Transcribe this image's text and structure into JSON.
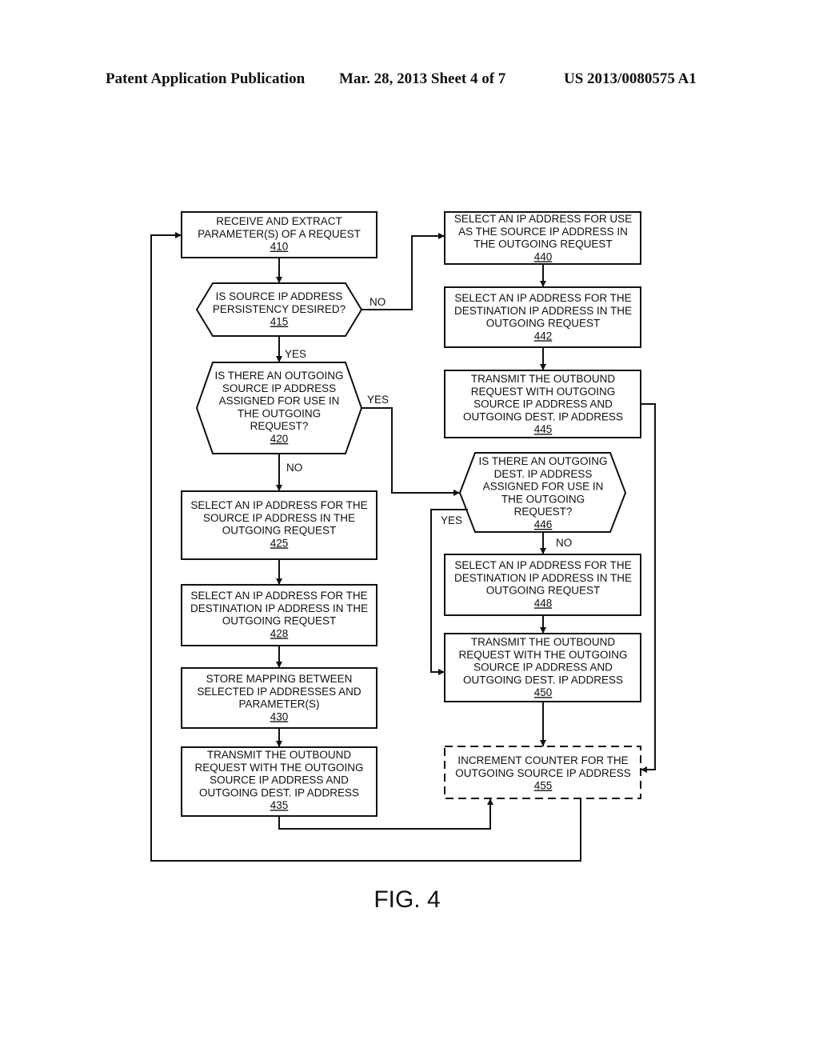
{
  "header": {
    "left": "Patent Application Publication",
    "center": "Mar. 28, 2013  Sheet 4 of 7",
    "right": "US 2013/0080575 A1"
  },
  "figure_label": "FIG. 4",
  "nodes": {
    "n410": {
      "lines": [
        "RECEIVE AND EXTRACT",
        "PARAMETER(S) OF A REQUEST"
      ],
      "ref": "410",
      "shape": "process"
    },
    "n415": {
      "lines": [
        "IS SOURCE IP ADDRESS",
        "PERSISTENCY DESIRED?"
      ],
      "ref": "415",
      "shape": "decision"
    },
    "n420": {
      "lines": [
        "IS THERE AN OUTGOING",
        "SOURCE IP ADDRESS",
        "ASSIGNED FOR USE IN",
        "THE OUTGOING",
        "REQUEST?"
      ],
      "ref": "420",
      "shape": "decision"
    },
    "n425": {
      "lines": [
        "SELECT AN IP ADDRESS FOR THE",
        "SOURCE IP ADDRESS IN THE",
        "OUTGOING REQUEST"
      ],
      "ref": "425",
      "shape": "process"
    },
    "n428": {
      "lines": [
        "SELECT AN IP ADDRESS FOR THE",
        "DESTINATION IP ADDRESS IN THE",
        "OUTGOING REQUEST"
      ],
      "ref": "428",
      "shape": "process"
    },
    "n430": {
      "lines": [
        "STORE MAPPING BETWEEN",
        "SELECTED IP ADDRESSES AND",
        "PARAMETER(S)"
      ],
      "ref": "430",
      "shape": "process"
    },
    "n435": {
      "lines": [
        "TRANSMIT THE OUTBOUND",
        "REQUEST WITH THE OUTGOING",
        "SOURCE IP ADDRESS AND",
        "OUTGOING DEST. IP ADDRESS"
      ],
      "ref": "435",
      "shape": "process"
    },
    "n440": {
      "lines": [
        "SELECT AN IP ADDRESS FOR USE",
        "AS THE SOURCE IP ADDRESS IN",
        "THE OUTGOING REQUEST"
      ],
      "ref": "440",
      "shape": "process"
    },
    "n442": {
      "lines": [
        "SELECT AN IP ADDRESS FOR THE",
        "DESTINATION IP ADDRESS IN THE",
        "OUTGOING REQUEST"
      ],
      "ref": "442",
      "shape": "process"
    },
    "n445": {
      "lines": [
        "TRANSMIT THE OUTBOUND",
        "REQUEST WITH  OUTGOING",
        "SOURCE IP ADDRESS AND",
        "OUTGOING DEST. IP ADDRESS"
      ],
      "ref": "445",
      "shape": "process"
    },
    "n446": {
      "lines": [
        "IS THERE AN OUTGOING",
        "DEST. IP ADDRESS",
        "ASSIGNED FOR USE IN",
        "THE OUTGOING",
        "REQUEST?"
      ],
      "ref": "446",
      "shape": "decision"
    },
    "n448": {
      "lines": [
        "SELECT AN IP ADDRESS FOR THE",
        "DESTINATION IP ADDRESS IN THE",
        "OUTGOING REQUEST"
      ],
      "ref": "448",
      "shape": "process"
    },
    "n450": {
      "lines": [
        "TRANSMIT THE OUTBOUND",
        "REQUEST WITH THE OUTGOING",
        "SOURCE IP ADDRESS AND",
        "OUTGOING DEST. IP ADDRESS"
      ],
      "ref": "450",
      "shape": "process"
    },
    "n455": {
      "lines": [
        "INCREMENT COUNTER FOR THE",
        "OUTGOING SOURCE IP ADDRESS"
      ],
      "ref": "455",
      "shape": "optional-process"
    }
  },
  "edge_labels": {
    "e415_no": "NO",
    "e415_yes": "YES",
    "e420_yes": "YES",
    "e420_no": "NO",
    "e446_yes": "YES",
    "e446_no": "NO"
  },
  "edges": [
    {
      "from": "410",
      "to": "415"
    },
    {
      "from": "415",
      "to": "440",
      "label": "NO"
    },
    {
      "from": "415",
      "to": "420",
      "label": "YES"
    },
    {
      "from": "420",
      "to": "446",
      "label": "YES"
    },
    {
      "from": "420",
      "to": "425",
      "label": "NO"
    },
    {
      "from": "425",
      "to": "428"
    },
    {
      "from": "428",
      "to": "430"
    },
    {
      "from": "430",
      "to": "435"
    },
    {
      "from": "435",
      "to": "455"
    },
    {
      "from": "440",
      "to": "442"
    },
    {
      "from": "442",
      "to": "445"
    },
    {
      "from": "445",
      "to": "455"
    },
    {
      "from": "446",
      "to": "450",
      "label": "YES"
    },
    {
      "from": "446",
      "to": "448",
      "label": "NO"
    },
    {
      "from": "448",
      "to": "450"
    },
    {
      "from": "450",
      "to": "455"
    },
    {
      "from": "455",
      "to": "410"
    }
  ]
}
